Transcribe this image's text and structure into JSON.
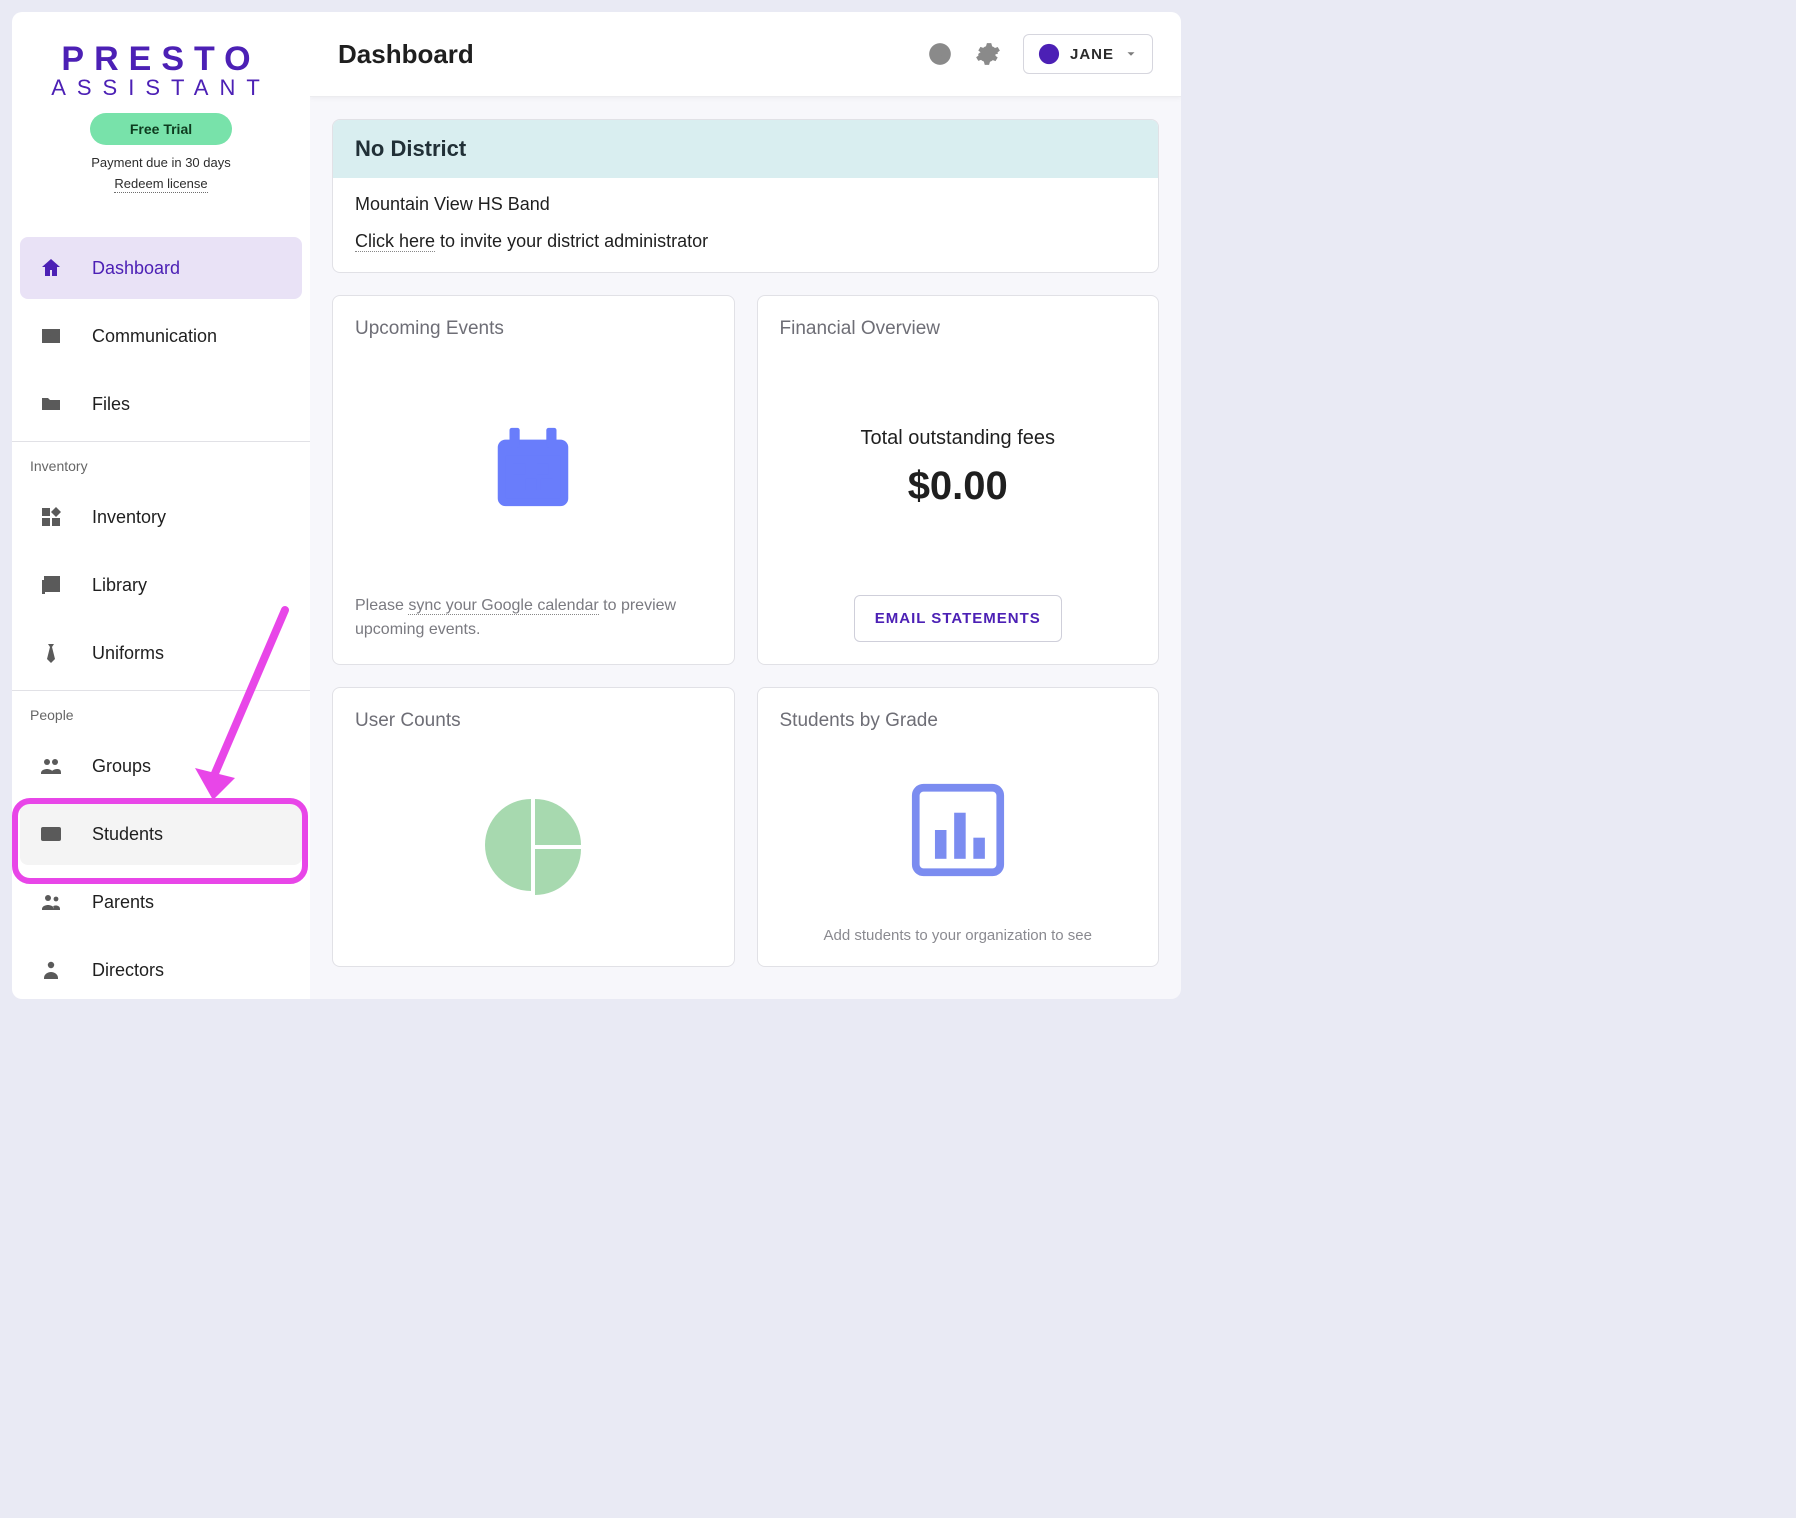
{
  "brand": {
    "line1": "PRESTO",
    "line2": "ASSISTANT"
  },
  "trial": {
    "chip": "Free Trial",
    "due": "Payment due in 30 days",
    "redeem": "Redeem license"
  },
  "nav": {
    "main": [
      {
        "icon": "home",
        "label": "Dashboard"
      },
      {
        "icon": "mail",
        "label": "Communication"
      },
      {
        "icon": "folder",
        "label": "Files"
      }
    ],
    "section_inventory": "Inventory",
    "inventory": [
      {
        "icon": "widgets",
        "label": "Inventory"
      },
      {
        "icon": "library",
        "label": "Library"
      },
      {
        "icon": "tie",
        "label": "Uniforms"
      }
    ],
    "section_people": "People",
    "people": [
      {
        "icon": "groups",
        "label": "Groups"
      },
      {
        "icon": "badge",
        "label": "Students"
      },
      {
        "icon": "people",
        "label": "Parents"
      },
      {
        "icon": "person",
        "label": "Directors"
      }
    ]
  },
  "topbar": {
    "title": "Dashboard",
    "user": "JANE"
  },
  "district": {
    "heading": "No District",
    "org": "Mountain View HS Band",
    "invite_link": "Click here",
    "invite_rest": " to invite your district administrator"
  },
  "cards": {
    "events": {
      "title": "Upcoming Events",
      "note_pre": "Please ",
      "note_link": "sync your Google calendar",
      "note_post": " to preview upcoming events."
    },
    "finance": {
      "title": "Financial Overview",
      "label": "Total outstanding fees",
      "amount": "$0.00",
      "button": "EMAIL STATEMENTS"
    },
    "user_counts": {
      "title": "User Counts"
    },
    "by_grade": {
      "title": "Students by Grade",
      "note": "Add students to your organization to see"
    }
  }
}
